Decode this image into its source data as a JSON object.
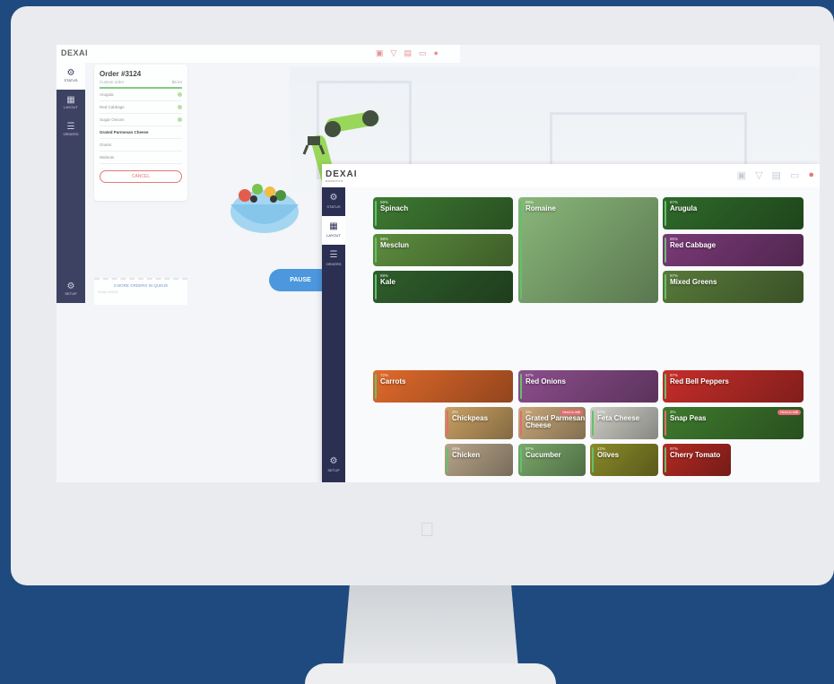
{
  "background_app": {
    "logo": "DEXAI",
    "sidebar": [
      {
        "label": "STATUS",
        "icon": "robot-arm-icon"
      },
      {
        "label": "LAYOUT",
        "icon": "grid-icon"
      },
      {
        "label": "ORDERS",
        "icon": "list-icon"
      }
    ],
    "setup_label": "SETUP",
    "order": {
      "title": "Order #3124",
      "subtitle": "Custom order",
      "price": "$8.54",
      "items": [
        "Arugula",
        "Red Cabbage",
        "Sugar Onions",
        "Grated Parmesan Cheese",
        "Grains",
        "Walnuts"
      ],
      "cancel_label": "CANCEL"
    },
    "queue": {
      "line1": "3 MORE ORDERS IN QUEUE",
      "line2": "Order #3125"
    },
    "pause_label": "PAUSE"
  },
  "app": {
    "logo": "DEXAI",
    "logo_sub": "ROBOTICS",
    "sidebar": [
      {
        "label": "STATUS",
        "icon": "robot-arm-icon"
      },
      {
        "label": "LAYOUT",
        "icon": "grid-icon"
      },
      {
        "label": "ORDERS",
        "icon": "list-icon"
      }
    ],
    "setup_label": "SETUP",
    "top_icons": [
      "bowl-icon",
      "cone-icon",
      "container-icon",
      "box-icon",
      "alert-icon"
    ],
    "ingredients": [
      {
        "name": "Spinach",
        "pct": "59%",
        "color": "#3e7a32"
      },
      {
        "name": "Romaine",
        "pct": "99%",
        "color": "#8ab77a"
      },
      {
        "name": "Arugula",
        "pct": "67%",
        "color": "#2f6a2a"
      },
      {
        "name": "Mesclun",
        "pct": "98%",
        "color": "#5d8d3e"
      },
      {
        "name": "Red Cabbage",
        "pct": "85%",
        "color": "#7b3a78"
      },
      {
        "name": "Kale",
        "pct": "99%",
        "color": "#2f5e2c"
      },
      {
        "name": "Mixed Greens",
        "pct": "97%",
        "color": "#587a3a"
      },
      {
        "name": "Carrots",
        "pct": "72%",
        "color": "#e06a2c"
      },
      {
        "name": "Red Onions",
        "pct": "67%",
        "color": "#8c4e8c"
      },
      {
        "name": "Red Bell Peppers",
        "pct": "97%",
        "color": "#c62e2a"
      },
      {
        "name": "Chickpeas",
        "pct": "2%",
        "color": "#c9a163"
      },
      {
        "name": "Grated Parmesan Cheese",
        "pct": "1%",
        "color": "#c9a97a",
        "badge": "Need to refill"
      },
      {
        "name": "Feta Cheese",
        "pct": "97%",
        "color": "#cfcfc7"
      },
      {
        "name": "Snap Peas",
        "pct": "3%",
        "color": "#3e7a2e",
        "badge": "Need to refill"
      },
      {
        "name": "Chicken",
        "pct": "45%",
        "color": "#b8a58a"
      },
      {
        "name": "Cucumber",
        "pct": "97%",
        "color": "#7aa86a"
      },
      {
        "name": "Olives",
        "pct": "42%",
        "color": "#8a8a2a"
      },
      {
        "name": "Cherry Tomato",
        "pct": "97%",
        "color": "#b32a24"
      }
    ]
  }
}
